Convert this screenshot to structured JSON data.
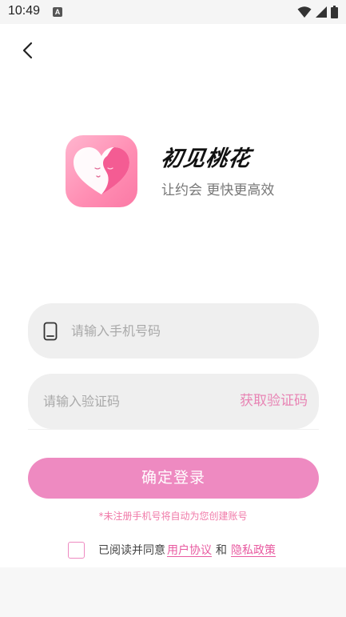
{
  "status_bar": {
    "time": "10:49",
    "notification_badge": "A",
    "icons": [
      "wifi-icon",
      "signal-icon",
      "battery-icon"
    ]
  },
  "header": {
    "back_icon": "chevron-left-icon"
  },
  "brand": {
    "logo_icon": "heart-faces-logo",
    "title": "初见桃花",
    "slogan": "让约会 更快更高效"
  },
  "form": {
    "phone_placeholder": "请输入手机号码",
    "phone_value": "",
    "phone_icon": "phone-icon",
    "code_placeholder": "请输入验证码",
    "code_value": "",
    "get_code_label": "获取验证码",
    "submit_label": "确定登录",
    "auto_register_note": "*未注册手机号将自动为您创建账号"
  },
  "agreement": {
    "checked": false,
    "prefix": "已阅读并同意",
    "user_agreement": "用户协议",
    "and": "和",
    "privacy_policy": "隐私政策"
  },
  "colors": {
    "accent": "#ee8ac1",
    "link": "#e85aa0",
    "input_bg": "#efefef",
    "logo_pink": "#ff8fb4"
  }
}
